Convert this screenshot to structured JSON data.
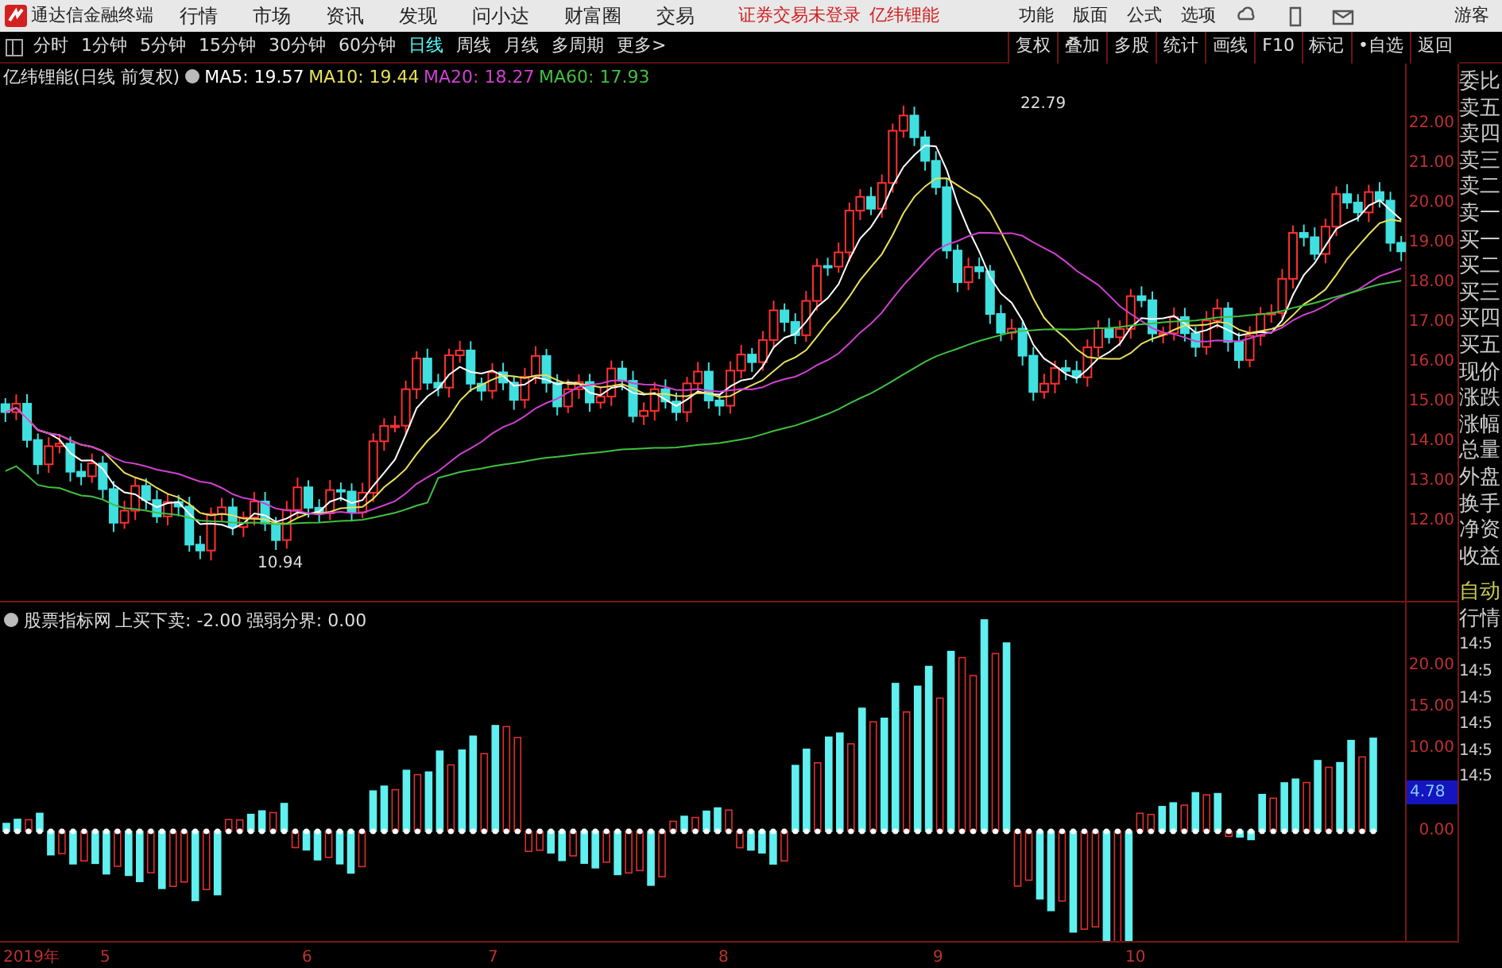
{
  "title_bar": {
    "app_name": "通达信金融终端",
    "menus": [
      "行情",
      "市场",
      "资讯",
      "发现",
      "问小达",
      "财富圈",
      "交易"
    ],
    "notice": "证券交易未登录",
    "stock": "亿纬锂能",
    "tools": [
      "功能",
      "版面",
      "公式",
      "选项"
    ],
    "user": "游客"
  },
  "period_bar": {
    "periods": [
      {
        "label": "分时",
        "selected": false
      },
      {
        "label": "1分钟",
        "selected": false
      },
      {
        "label": "5分钟",
        "selected": false
      },
      {
        "label": "15分钟",
        "selected": false
      },
      {
        "label": "30分钟",
        "selected": false
      },
      {
        "label": "60分钟",
        "selected": false
      },
      {
        "label": "日线",
        "selected": true
      },
      {
        "label": "周线",
        "selected": false
      },
      {
        "label": "月线",
        "selected": false
      },
      {
        "label": "多周期",
        "selected": false
      },
      {
        "label": "更多>",
        "selected": false
      }
    ],
    "actions": [
      "复权",
      "叠加",
      "多股",
      "统计",
      "画线",
      "F10",
      "标记",
      "•自选",
      "返回"
    ]
  },
  "main_chart": {
    "title": "亿纬锂能(日线 前复权)",
    "indicators": [
      {
        "label": "MA5: 19.57",
        "color": "#ffffff"
      },
      {
        "label": "MA10: 19.44",
        "color": "#e8e05a"
      },
      {
        "label": "MA20: 18.27",
        "color": "#d040d0"
      },
      {
        "label": "MA60: 17.93",
        "color": "#40c040"
      }
    ],
    "y_labels": [
      "22.00",
      "21.00",
      "20.00",
      "19.00",
      "18.00",
      "17.00",
      "16.00",
      "15.00",
      "14.00",
      "13.00",
      "12.00"
    ],
    "high_label": "22.79",
    "low_label": "10.94"
  },
  "indicator_panel": {
    "title": "股票指标网",
    "readings": [
      "上买下卖: -2.00",
      "强弱分界: 0.00"
    ],
    "y_labels": [
      "20.00",
      "15.00",
      "10.00",
      "0.00"
    ],
    "current": "4.78"
  },
  "x_axis": [
    "2019年",
    "5",
    "6",
    "7",
    "8",
    "9",
    "10"
  ],
  "sidebar": {
    "quote_items": [
      "委比",
      "卖五",
      "卖四",
      "卖三",
      "卖二",
      "卖一",
      "买一",
      "买二",
      "买三",
      "买四",
      "买五",
      "现价",
      "涨跌",
      "涨幅",
      "总量",
      "外盘",
      "换手",
      "净资",
      "收益"
    ],
    "status": [
      "自动",
      "行情"
    ],
    "times": [
      "14:5",
      "14:5",
      "14:5",
      "14:5",
      "14:5",
      "14:5"
    ]
  }
}
